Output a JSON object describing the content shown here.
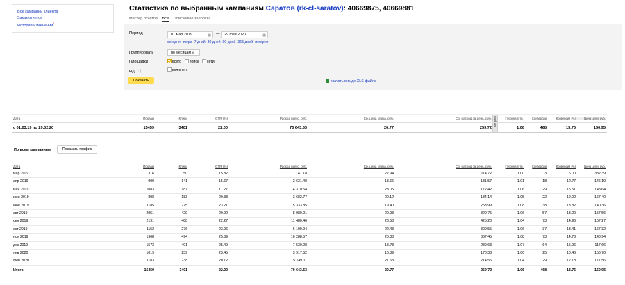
{
  "side_links": [
    "Все кампании клиента",
    "Заказ отчетов",
    "История изменений"
  ],
  "side_new_badge": "1",
  "title": {
    "prefix": "Статистика по выбранным кампаниям",
    "campaign": "Саратов (rk-cl-saratov)",
    "ids": ": 40669875, 40669881"
  },
  "tabs": [
    {
      "label": "Мастер отчетов",
      "active": false
    },
    {
      "label": "Все",
      "active": true
    },
    {
      "label": "Поисковые запросы",
      "active": false
    }
  ],
  "filters": {
    "period_label": "Период",
    "date_from": "01 мар 2019",
    "date_sep": "—",
    "date_to": "29 фев 2020",
    "quick_ranges": [
      "сегодня",
      "вчера",
      "7 дней",
      "30 дней",
      "90 дней",
      "365 дней",
      "история"
    ],
    "group_label": "Группировать",
    "group_value": "по месяцам",
    "platforms_label": "Площадки",
    "platforms": [
      {
        "label": "всего",
        "checked": true
      },
      {
        "label": "поиск",
        "checked": false
      },
      {
        "label": "сети",
        "checked": false
      }
    ],
    "vat_label": "НДС",
    "vat_option": "включен",
    "show_button": "Показать",
    "xls_link": "скачать в виде XLS-файла"
  },
  "summary": {
    "headers": [
      "Дата",
      "Показы",
      "Клики",
      "CTR (%)",
      "Расход всего, руб.",
      "Ср. цена клика, руб.",
      "Ср. расход за день, руб.",
      "Глубина (стр.)",
      "Конверсии",
      "Конверсия (%)",
      "Цена цели, руб."
    ],
    "divider_label": "Метрика",
    "row": [
      "с 01.03.19 по 29.02.20",
      "15459",
      "3401",
      "22.00",
      "70 643.53",
      "20.77",
      "259.72",
      "1.06",
      "468",
      "13.76",
      "150.95"
    ]
  },
  "campaigns": {
    "title": "По всем кампаниям",
    "chart_button": "Показать график",
    "headers": [
      "Дата",
      "Показы",
      "Клики",
      "CTR (%)",
      "Расход всего, руб.",
      "Ср. цена клика, руб.",
      "Ср. расход за день, руб.",
      "Глубина (стр.)",
      "Конверсии",
      "Конверсия (%)",
      "Цена цели, руб."
    ],
    "rows": [
      [
        "мар 2019",
        "316",
        "50",
        "15.82",
        "1 147.18",
        "22.94",
        "114.72",
        "1.00",
        "3",
        "6.00",
        "382.39"
      ],
      [
        "апр 2019",
        "900",
        "141",
        "15.67",
        "2 631.40",
        "18.66",
        "131.57",
        "1.01",
        "18",
        "12.77",
        "146.19"
      ],
      [
        "май 2019",
        "1083",
        "187",
        "17.27",
        "4 310.54",
        "23.05",
        "172.42",
        "1.06",
        "29",
        "15.51",
        "148.64"
      ],
      [
        "июн 2019",
        "898",
        "183",
        "20.38",
        "3 682.77",
        "20.12",
        "184.14",
        "1.05",
        "22",
        "12.02",
        "167.40"
      ],
      [
        "июл 2019",
        "1185",
        "275",
        "23.21",
        "5 333.85",
        "19.40",
        "253.99",
        "1.08",
        "38",
        "13.82",
        "140.36"
      ],
      [
        "авг 2019",
        "2051",
        "429",
        "20.92",
        "8 980.91",
        "20.93",
        "320.75",
        "1.06",
        "57",
        "13.29",
        "157.56"
      ],
      [
        "сен 2019",
        "2191",
        "488",
        "22.27",
        "11 480.46",
        "23.53",
        "425.20",
        "1.04",
        "73",
        "14.96",
        "157.27"
      ],
      [
        "окт 2019",
        "1152",
        "276",
        "23.96",
        "6 190.94",
        "22.43",
        "309.55",
        "1.06",
        "37",
        "13.41",
        "167.32"
      ],
      [
        "ноя 2019",
        "1908",
        "494",
        "25.89",
        "10 288.57",
        "20.83",
        "367.45",
        "1.08",
        "73",
        "14.78",
        "140.94"
      ],
      [
        "дек 2019",
        "1573",
        "401",
        "25.49",
        "7 530.28",
        "18.78",
        "289.63",
        "1.07",
        "64",
        "15.96",
        "117.66"
      ],
      [
        "янв 2020",
        "1019",
        "239",
        "23.45",
        "3 917.52",
        "16.39",
        "170.33",
        "1.06",
        "25",
        "10.46",
        "156.70"
      ],
      [
        "фев 2020",
        "1183",
        "238",
        "20.12",
        "5 149.11",
        "21.63",
        "214.55",
        "1.04",
        "29",
        "12.18",
        "177.56"
      ]
    ],
    "total": [
      "Итого",
      "15459",
      "3401",
      "22.00",
      "70 643.53",
      "20.77",
      "259.72",
      "1.06",
      "468",
      "13.76",
      "150.95"
    ]
  }
}
